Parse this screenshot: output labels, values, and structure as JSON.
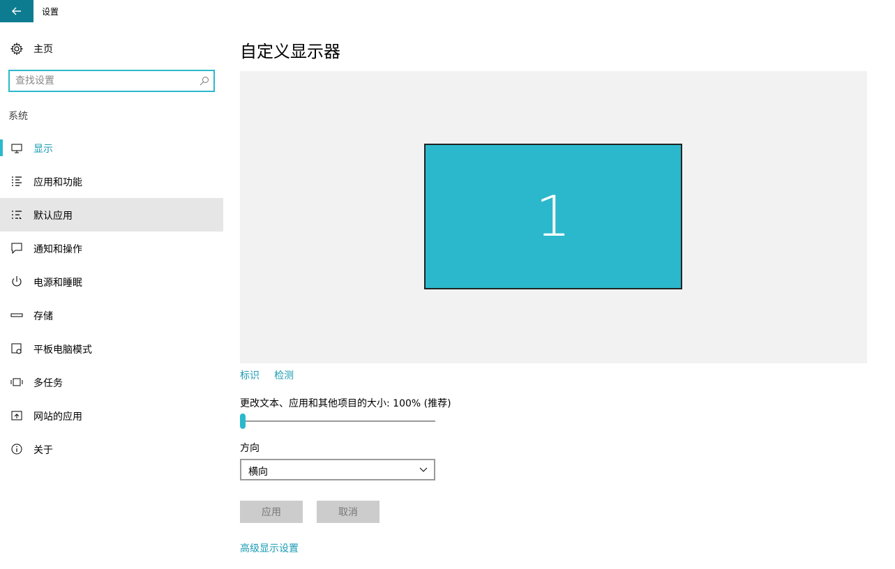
{
  "window": {
    "title": "设置"
  },
  "sidebar": {
    "home_label": "主页",
    "search_placeholder": "查找设置",
    "section_label": "系统",
    "items": [
      {
        "label": "显示",
        "icon": "monitor-icon",
        "state": "active"
      },
      {
        "label": "应用和功能",
        "icon": "apps-list-icon"
      },
      {
        "label": "默认应用",
        "icon": "default-apps-icon",
        "state": "hover"
      },
      {
        "label": "通知和操作",
        "icon": "notification-icon"
      },
      {
        "label": "电源和睡眠",
        "icon": "power-icon"
      },
      {
        "label": "存储",
        "icon": "storage-icon"
      },
      {
        "label": "平板电脑模式",
        "icon": "tablet-mode-icon"
      },
      {
        "label": "多任务",
        "icon": "multitask-icon"
      },
      {
        "label": "网站的应用",
        "icon": "web-apps-icon"
      },
      {
        "label": "关于",
        "icon": "info-icon"
      }
    ]
  },
  "main": {
    "title": "自定义显示器",
    "monitor_number": "1",
    "identify_link": "标识",
    "detect_link": "检测",
    "scale_label": "更改文本、应用和其他项目的大小: 100% (推荐)",
    "scale_fraction": 0.0,
    "orientation_label": "方向",
    "orientation_value": "横向",
    "apply_button": "应用",
    "cancel_button": "取消",
    "advanced_link": "高级显示设置"
  },
  "colors": {
    "accent": "#2bb8cc",
    "link": "#1a9bb3",
    "back_button": "#0e7c90"
  }
}
